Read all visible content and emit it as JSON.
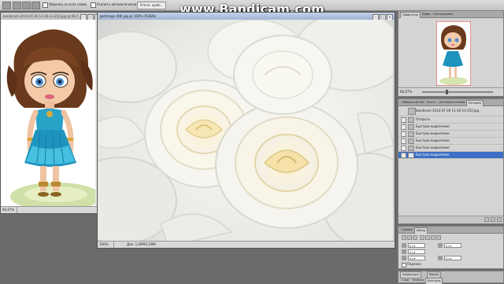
{
  "watermark": "www.Bandicam.com",
  "options_bar": {
    "add_to_selection_label": "Образец со всех слоев",
    "auto_enhance_label": "Усилить автоматически",
    "refine_edge_label": "Уточн. край..."
  },
  "doc_left": {
    "title": "bandicam 2014-07-30 13-16-13-252.jpg @ 66,7...",
    "zoom": "66,67%",
    "status_info": ""
  },
  "doc_main": {
    "title": "getImage (98).jpg @ 100% (RGB/8)",
    "zoom": "100%",
    "status_info": "Док: 1,09M/1,09M"
  },
  "navigator_panel": {
    "tabs": [
      "Навигатор",
      "Инфо",
      "Гистограмма"
    ],
    "active_tab": 0,
    "zoom": "66,67%"
  },
  "history_panel": {
    "tabs": [
      "Наборы кистей",
      "Кисть",
      "Источник клонов",
      "История"
    ],
    "active_tab": 3,
    "snapshot_label": "bandicam 2014-07-30 13-16-13-252.jpg",
    "items": [
      {
        "label": "Открыть",
        "selected": false
      },
      {
        "label": "Быстрое выделение",
        "selected": false
      },
      {
        "label": "Быстрое выделение",
        "selected": false
      },
      {
        "label": "Быстрое выделение",
        "selected": false
      },
      {
        "label": "Быстрое выделение",
        "selected": false
      },
      {
        "label": "Быстрое выделение",
        "selected": true
      }
    ]
  },
  "character_panel": {
    "tabs": [
      "Символ",
      "Абзац"
    ],
    "active_tab": 1,
    "field_values": [
      "0 пт",
      "0 пт",
      "0 пт",
      "0 пт",
      "0 пт"
    ],
    "hyphenation_label": "Перенос"
  },
  "bottom_panels": {
    "correction_tab": "Коррекция",
    "mask_tab": "Маски",
    "layers_tabs": [
      "Слои",
      "Каналы",
      "Контуры"
    ],
    "active_layers_tab": 2
  },
  "colors": {
    "workspace": "#6b6b6b",
    "selection": "#3c6fc5",
    "title_active": "#9fb4d2"
  }
}
